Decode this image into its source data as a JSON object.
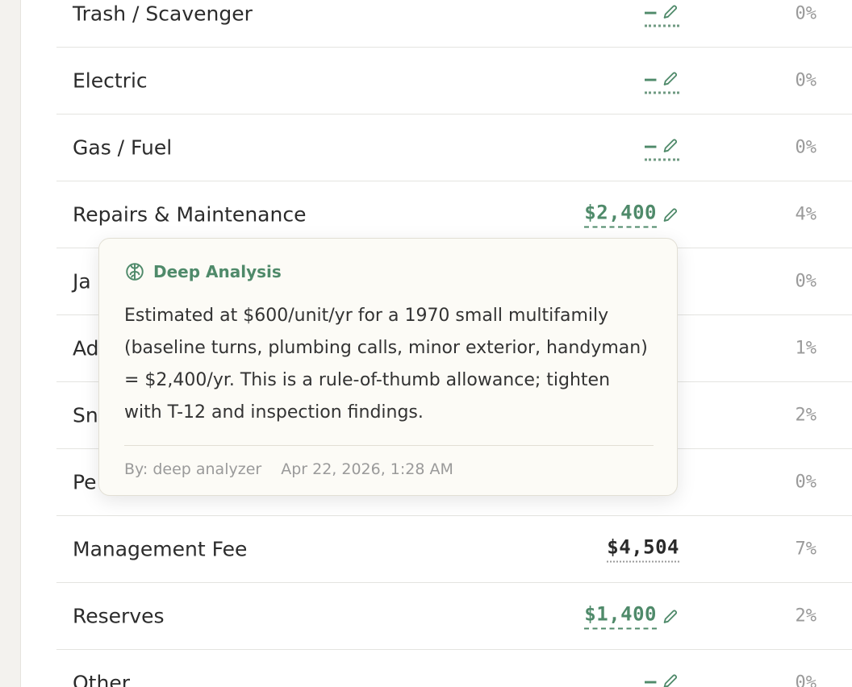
{
  "rows": [
    {
      "label": "Trash / Scavenger",
      "amount": "–",
      "kind": "dash",
      "pct": "0%"
    },
    {
      "label": "Electric",
      "amount": "–",
      "kind": "dash",
      "pct": "0%"
    },
    {
      "label": "Gas / Fuel",
      "amount": "–",
      "kind": "dash",
      "pct": "0%"
    },
    {
      "label": "Repairs & Maintenance",
      "amount": "$2,400",
      "kind": "green",
      "pct": "4%"
    },
    {
      "label": "Ja",
      "amount": "",
      "kind": "hidden",
      "pct": "0%"
    },
    {
      "label": "Ad",
      "amount": "",
      "kind": "hidden",
      "pct": "1%"
    },
    {
      "label": "Sn",
      "amount": "",
      "kind": "hidden",
      "pct": "2%"
    },
    {
      "label": "Pe",
      "amount": "",
      "kind": "hidden",
      "pct": "0%"
    },
    {
      "label": "Management Fee",
      "amount": "$4,504",
      "kind": "dark",
      "pct": "7%"
    },
    {
      "label": "Reserves",
      "amount": "$1,400",
      "kind": "green",
      "pct": "2%"
    },
    {
      "label": "Other",
      "amount": "–",
      "kind": "dash",
      "pct": "0%"
    }
  ],
  "tooltip": {
    "title": "Deep Analysis",
    "icon": "brain-icon",
    "body": "Estimated at $600/unit/yr for a 1970 small multifamily (baseline turns, plumbing calls, minor exterior, handyman) = $2,400/yr. This is a rule-of-thumb allowance; tighten with T-12 and inspection findings.",
    "author": "By: deep analyzer",
    "timestamp": "Apr 22, 2026, 1:28 AM"
  },
  "colors": {
    "accent": "#4f8a6a",
    "muted": "#9a9a9a",
    "tooltip_bg": "#fcfbf6"
  }
}
